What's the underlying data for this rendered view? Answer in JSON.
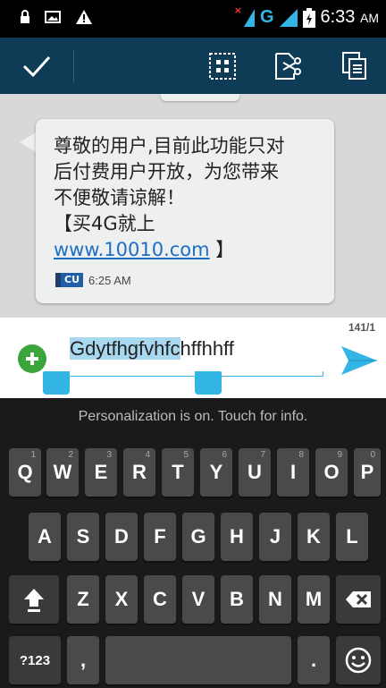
{
  "status_bar": {
    "icons": [
      "lock-icon",
      "image-icon",
      "warning-icon"
    ],
    "network": "G",
    "time": "6:33",
    "ampm": "AM"
  },
  "action_bar": {
    "buttons": [
      "check-icon",
      "select-all-icon",
      "cut-icon",
      "copy-icon"
    ]
  },
  "message": {
    "lines": [
      "尊敬的用户,目前此功能只对",
      "后付费用户开放，为您带来",
      "不便敬请谅解！",
      "【买4G就上"
    ],
    "link": "www.10010.com",
    "link_suffix": " 】",
    "sim_badge": "CU",
    "time": "6:25 AM"
  },
  "compose": {
    "char_count": "141/1",
    "text_selected": "Gdytfhgfvhfc",
    "text_rest": "hffhhff"
  },
  "keyboard": {
    "notice": "Personalization is on. Touch for info.",
    "row1": [
      {
        "label": "Q",
        "hint": "1"
      },
      {
        "label": "W",
        "hint": "2"
      },
      {
        "label": "E",
        "hint": "3"
      },
      {
        "label": "R",
        "hint": "4"
      },
      {
        "label": "T",
        "hint": "5"
      },
      {
        "label": "Y",
        "hint": "6"
      },
      {
        "label": "U",
        "hint": "7"
      },
      {
        "label": "I",
        "hint": "8"
      },
      {
        "label": "O",
        "hint": "9"
      },
      {
        "label": "P",
        "hint": "0"
      }
    ],
    "row2": [
      "A",
      "S",
      "D",
      "F",
      "G",
      "H",
      "J",
      "K",
      "L"
    ],
    "row3": [
      "Z",
      "X",
      "C",
      "V",
      "B",
      "N",
      "M"
    ],
    "symbols_label": "?123",
    "comma_label": ",",
    "period_label": "."
  }
}
